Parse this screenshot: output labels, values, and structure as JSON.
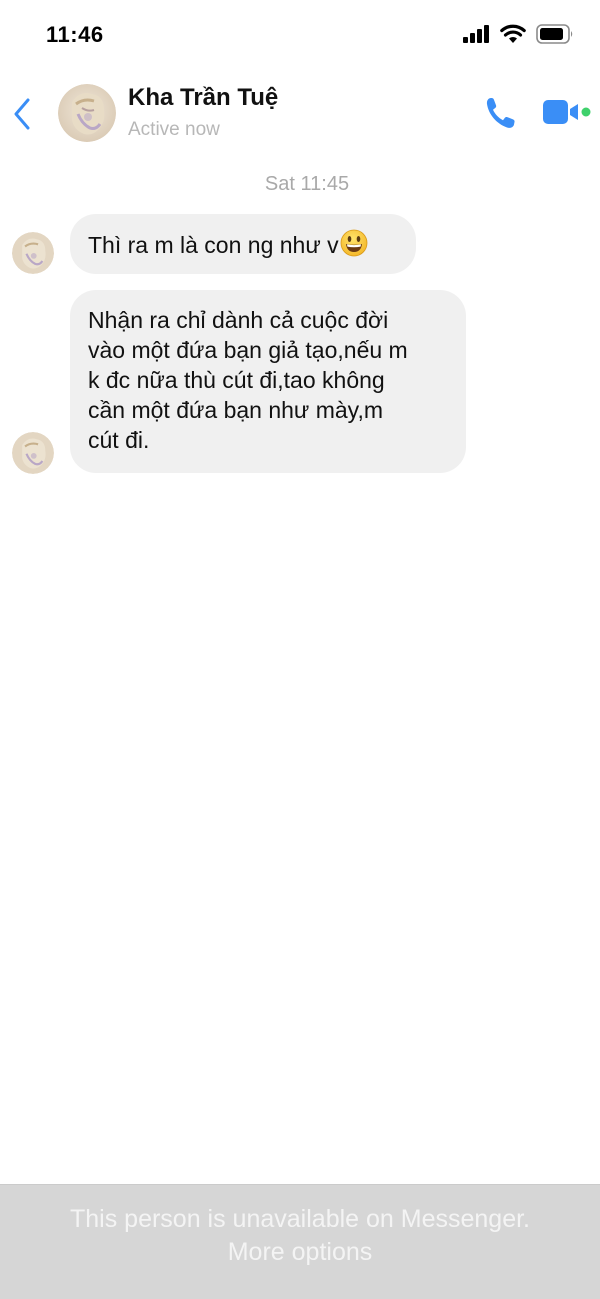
{
  "status_bar": {
    "time": "11:46",
    "icons": [
      "cellular-signal-icon",
      "wifi-icon",
      "battery-icon"
    ]
  },
  "header": {
    "back_icon": "chevron-left-icon",
    "contact_name": "Kha Trần Tuệ",
    "contact_status": "Active now",
    "call_icon": "phone-icon",
    "video_icon": "video-camera-icon",
    "accent_color": "#3a8ef6",
    "online_color": "#3fd16c"
  },
  "conversation": {
    "timestamp": "Sat 11:45",
    "messages": [
      {
        "sender": "contact",
        "lines": [
          "Thì ra m là con ng như v"
        ],
        "emoji": "grinning-face-emoji"
      },
      {
        "sender": "contact",
        "lines": [
          "Nhận ra chỉ dành cả cuộc đời",
          "vào một đứa bạn giả tạo,nếu m",
          "k đc nữa thù cút đi,tao không",
          "cần một đứa bạn như mày,m",
          "cút đi."
        ]
      }
    ]
  },
  "bottom_banner": {
    "text": "This person is unavailable on Messenger.",
    "link": "More options",
    "background": "#d6d6d6"
  }
}
